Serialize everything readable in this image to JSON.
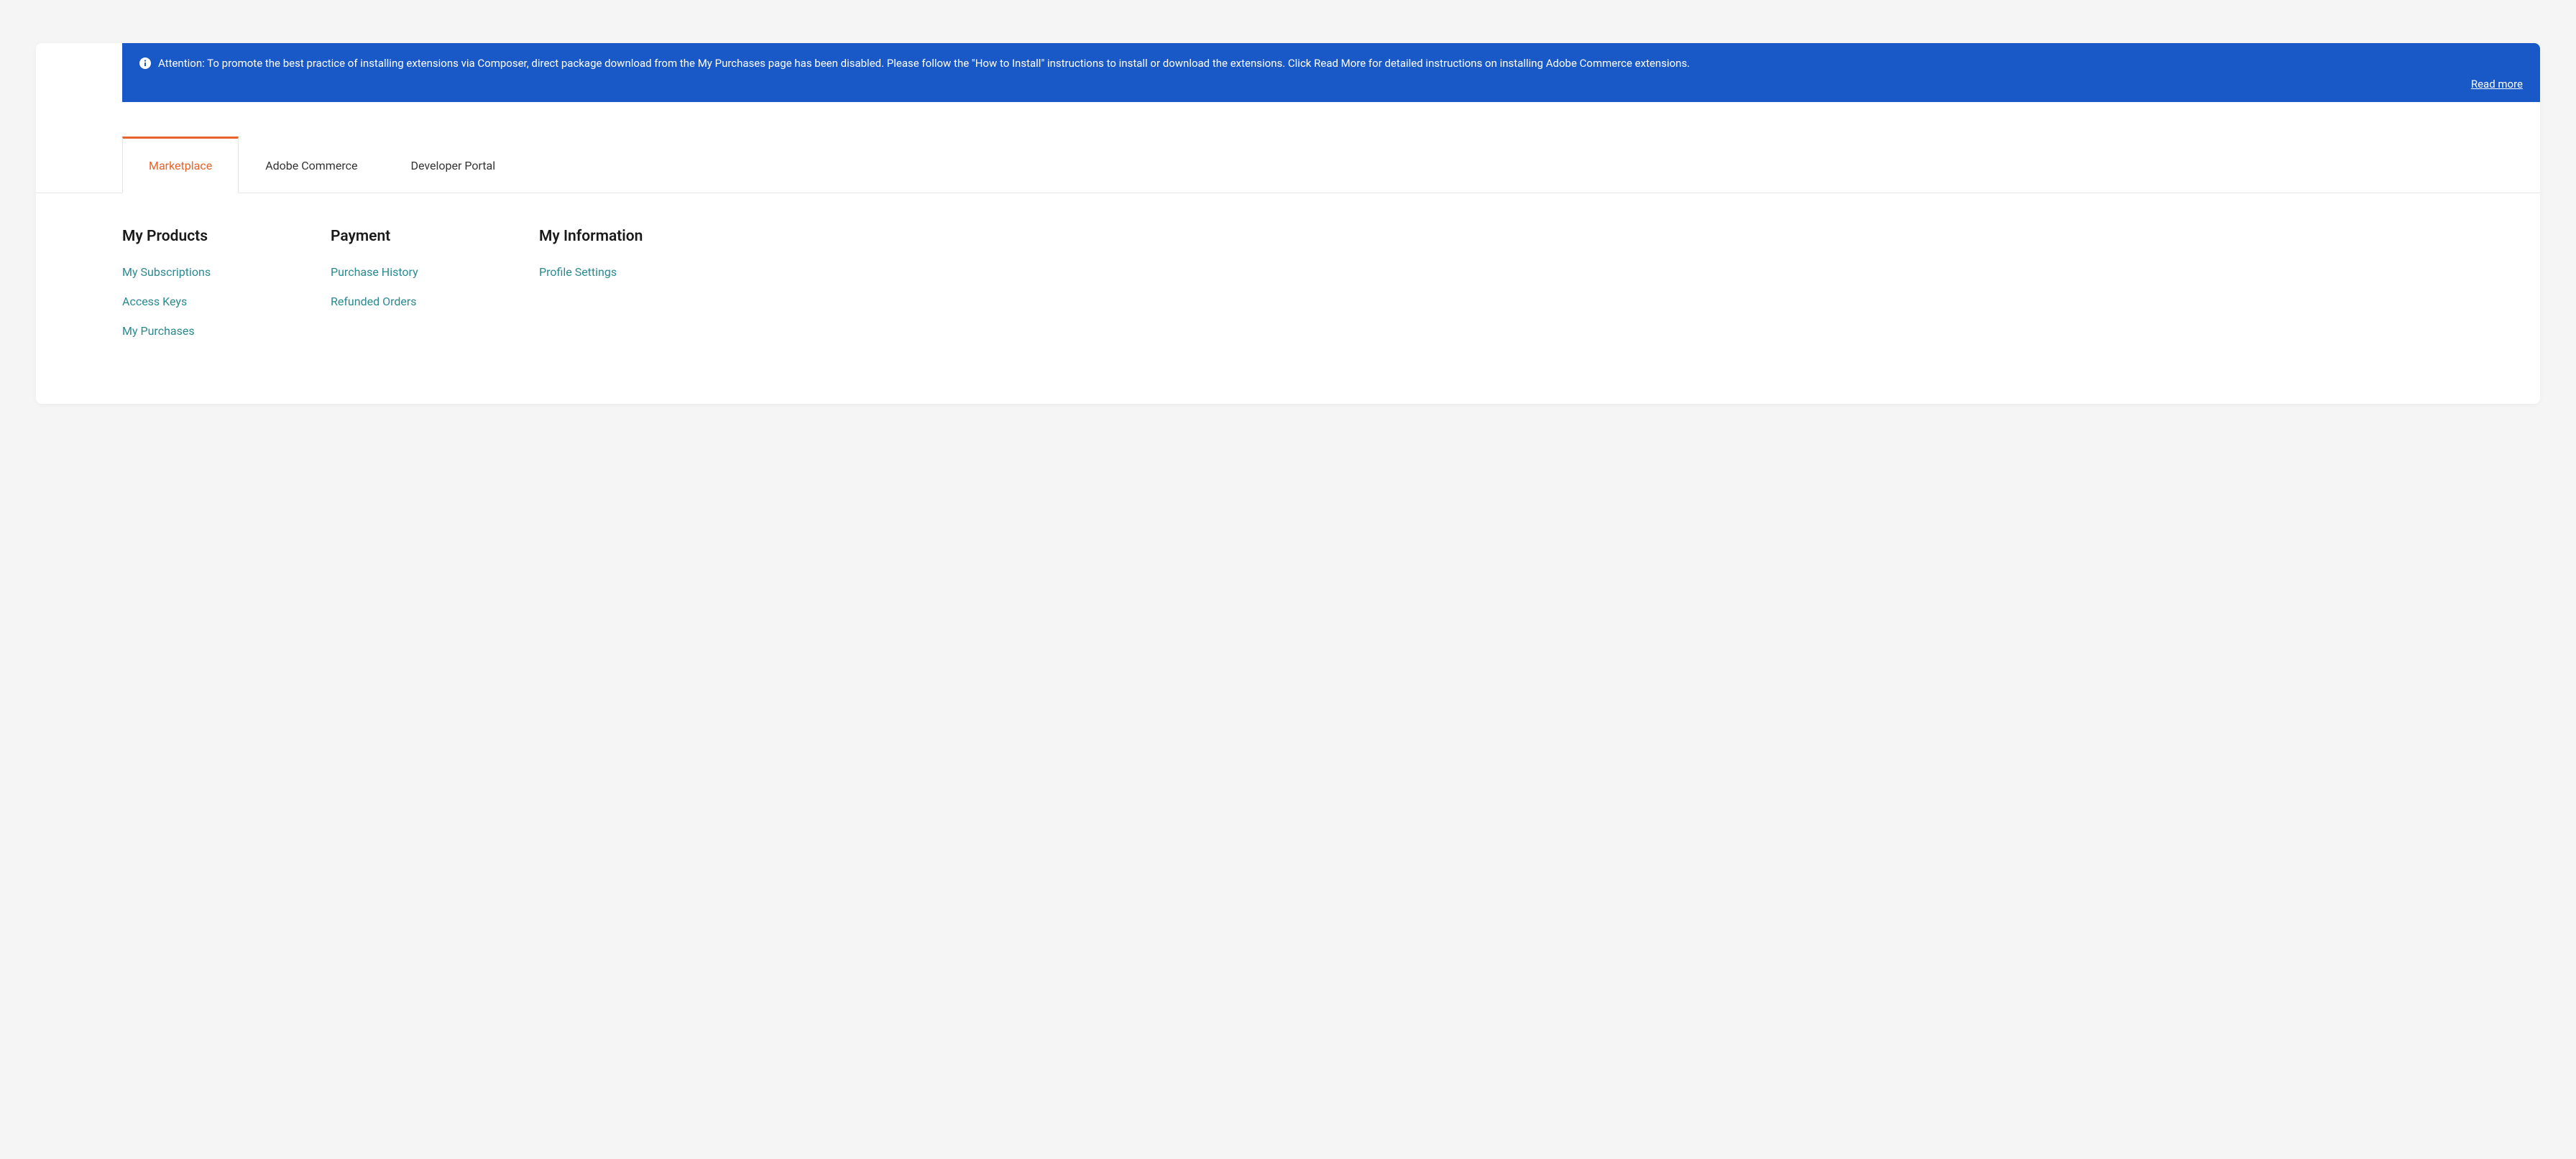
{
  "banner": {
    "text": "Attention: To promote the best practice of installing extensions via Composer, direct package download from the My Purchases page has been disabled. Please follow the \"How to Install\" instructions to install or download the extensions. Click Read More for detailed instructions on installing Adobe Commerce extensions.",
    "read_more": "Read more"
  },
  "tabs": [
    {
      "label": "Marketplace",
      "active": true
    },
    {
      "label": "Adobe Commerce",
      "active": false
    },
    {
      "label": "Developer Portal",
      "active": false
    }
  ],
  "columns": [
    {
      "heading": "My Products",
      "links": [
        {
          "label": "My Subscriptions"
        },
        {
          "label": "Access Keys"
        },
        {
          "label": "My Purchases"
        }
      ]
    },
    {
      "heading": "Payment",
      "links": [
        {
          "label": "Purchase History"
        },
        {
          "label": "Refunded Orders"
        }
      ]
    },
    {
      "heading": "My Information",
      "links": [
        {
          "label": "Profile Settings"
        }
      ]
    }
  ]
}
